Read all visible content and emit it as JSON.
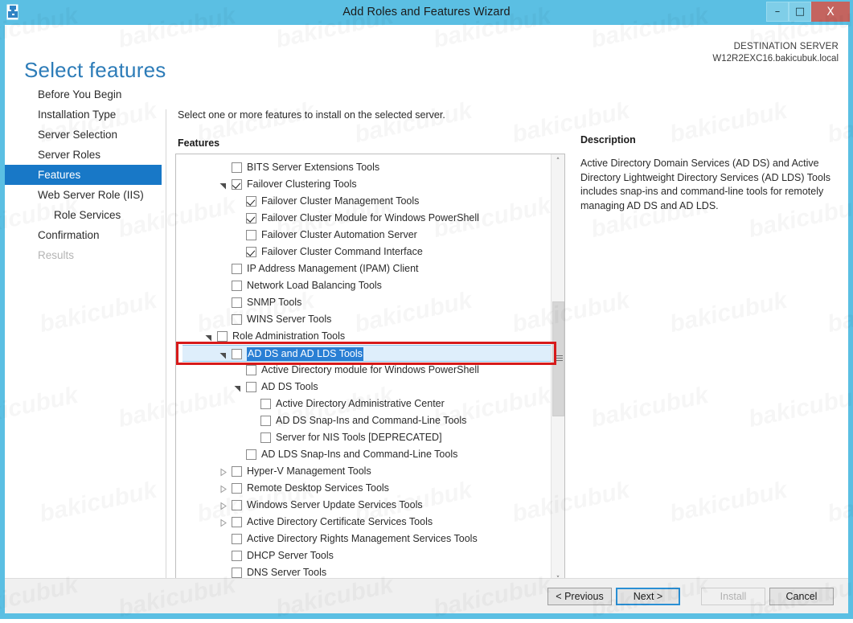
{
  "window": {
    "title": "Add Roles and Features Wizard",
    "icon": "wizard-icon",
    "controls": {
      "minimize": "–",
      "maximize": "□",
      "close": "X"
    },
    "accent_color": "#5bbfe3",
    "close_color": "#c4645f"
  },
  "header": {
    "page_title": "Select features",
    "destination_label": "DESTINATION SERVER",
    "destination_server": "W12R2EXC16.bakicubuk.local",
    "title_color": "#2d7cb8"
  },
  "sidebar": {
    "selected_color": "#1878c7",
    "items": [
      {
        "label": "Before You Begin",
        "state": "normal",
        "indented": false
      },
      {
        "label": "Installation Type",
        "state": "normal",
        "indented": false
      },
      {
        "label": "Server Selection",
        "state": "normal",
        "indented": false
      },
      {
        "label": "Server Roles",
        "state": "normal",
        "indented": false
      },
      {
        "label": "Features",
        "state": "active",
        "indented": false
      },
      {
        "label": "Web Server Role (IIS)",
        "state": "normal",
        "indented": false
      },
      {
        "label": "Role Services",
        "state": "normal",
        "indented": true
      },
      {
        "label": "Confirmation",
        "state": "normal",
        "indented": false
      },
      {
        "label": "Results",
        "state": "disabled",
        "indented": false
      }
    ]
  },
  "main": {
    "instruction": "Select one or more features to install on the selected server.",
    "features_label": "Features",
    "tree": [
      {
        "label": "BITS Server Extensions Tools",
        "level": 1,
        "checked": false,
        "twisty": "none"
      },
      {
        "label": "Failover Clustering Tools",
        "level": 1,
        "checked": true,
        "twisty": "expanded"
      },
      {
        "label": "Failover Cluster Management Tools",
        "level": 2,
        "checked": true,
        "twisty": "none"
      },
      {
        "label": "Failover Cluster Module for Windows PowerShell",
        "level": 2,
        "checked": true,
        "twisty": "none"
      },
      {
        "label": "Failover Cluster Automation Server",
        "level": 2,
        "checked": false,
        "twisty": "none"
      },
      {
        "label": "Failover Cluster Command Interface",
        "level": 2,
        "checked": true,
        "twisty": "none"
      },
      {
        "label": "IP Address Management (IPAM) Client",
        "level": 1,
        "checked": false,
        "twisty": "none"
      },
      {
        "label": "Network Load Balancing Tools",
        "level": 1,
        "checked": false,
        "twisty": "none"
      },
      {
        "label": "SNMP Tools",
        "level": 1,
        "checked": false,
        "twisty": "none"
      },
      {
        "label": "WINS Server Tools",
        "level": 1,
        "checked": false,
        "twisty": "none"
      },
      {
        "label": "Role Administration Tools",
        "level": 0,
        "checked": false,
        "twisty": "expanded"
      },
      {
        "label": "AD DS and AD LDS Tools",
        "level": 1,
        "checked": false,
        "twisty": "expanded",
        "selected": true
      },
      {
        "label": "Active Directory module for Windows PowerShell",
        "level": 2,
        "checked": false,
        "twisty": "none"
      },
      {
        "label": "AD DS Tools",
        "level": 2,
        "checked": false,
        "twisty": "expanded"
      },
      {
        "label": "Active Directory Administrative Center",
        "level": 3,
        "checked": false,
        "twisty": "none"
      },
      {
        "label": "AD DS Snap-Ins and Command-Line Tools",
        "level": 3,
        "checked": false,
        "twisty": "none"
      },
      {
        "label": "Server for NIS Tools [DEPRECATED]",
        "level": 3,
        "checked": false,
        "twisty": "none"
      },
      {
        "label": "AD LDS Snap-Ins and Command-Line Tools",
        "level": 2,
        "checked": false,
        "twisty": "none"
      },
      {
        "label": "Hyper-V Management Tools",
        "level": 1,
        "checked": false,
        "twisty": "collapsed"
      },
      {
        "label": "Remote Desktop Services Tools",
        "level": 1,
        "checked": false,
        "twisty": "collapsed"
      },
      {
        "label": "Windows Server Update Services Tools",
        "level": 1,
        "checked": false,
        "twisty": "collapsed"
      },
      {
        "label": "Active Directory Certificate Services Tools",
        "level": 1,
        "checked": false,
        "twisty": "collapsed"
      },
      {
        "label": "Active Directory Rights Management Services Tools",
        "level": 1,
        "checked": false,
        "twisty": "none"
      },
      {
        "label": "DHCP Server Tools",
        "level": 1,
        "checked": false,
        "twisty": "none"
      },
      {
        "label": "DNS Server Tools",
        "level": 1,
        "checked": false,
        "twisty": "none"
      }
    ],
    "scrollbar": {
      "up_arrow": "˄",
      "down_arrow": "˅"
    }
  },
  "description": {
    "title": "Description",
    "body": "Active Directory Domain Services (AD DS) and Active Directory Lightweight Directory Services (AD LDS) Tools includes snap-ins and command-line tools for remotely managing AD DS and AD LDS."
  },
  "footer": {
    "previous": "< Previous",
    "next": "Next >",
    "install": "Install",
    "cancel": "Cancel",
    "install_enabled": false,
    "focus_color": "#2a8fd4"
  },
  "annotation": {
    "color": "#d71a1a",
    "target": "AD DS and AD LDS Tools"
  },
  "watermark": {
    "text": "bakicubuk"
  }
}
